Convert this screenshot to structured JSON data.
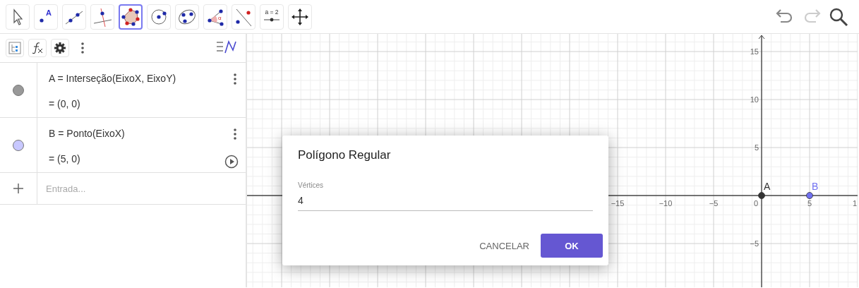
{
  "toolbar": {
    "tools": [
      {
        "kind": "move",
        "selected": false
      },
      {
        "kind": "point",
        "glyph": "A",
        "selected": false
      },
      {
        "kind": "line",
        "selected": false
      },
      {
        "kind": "perpendicular",
        "selected": false
      },
      {
        "kind": "polygon",
        "selected": true
      },
      {
        "kind": "circle",
        "selected": false
      },
      {
        "kind": "ellipse",
        "selected": false
      },
      {
        "kind": "angle",
        "glyph": "α",
        "selected": false
      },
      {
        "kind": "reflect",
        "selected": false
      },
      {
        "kind": "slider",
        "glyph": "a = 2",
        "selected": false
      },
      {
        "kind": "pan",
        "selected": false
      }
    ],
    "undo": {
      "disabled": false
    },
    "redo": {
      "disabled": true
    }
  },
  "algebra": {
    "items": [
      {
        "color": "#999999",
        "definition": "A = Interseção(EixoX, EixoY)",
        "value": "= (0, 0)",
        "play_button": false
      },
      {
        "color": "#c8c8ff",
        "definition": "B = Ponto(EixoX)",
        "value": "= (5, 0)",
        "play_button": true
      }
    ],
    "input": {
      "placeholder": "Entrada..."
    }
  },
  "graphics": {
    "x_labels": [
      "−15",
      "−10",
      "−5",
      "0",
      "5",
      "1"
    ],
    "y_labels": [
      "15",
      "10",
      "5",
      "−5"
    ],
    "points": [
      {
        "label": "A",
        "color": "#333333"
      },
      {
        "label": "B",
        "color": "#7070f0"
      }
    ]
  },
  "dialog": {
    "title": "Polígono Regular",
    "field_label": "Vértices",
    "field_value": "4",
    "buttons": [
      {
        "kind": "text",
        "label": "CANCELAR"
      },
      {
        "kind": "primary",
        "label": "OK"
      }
    ]
  }
}
